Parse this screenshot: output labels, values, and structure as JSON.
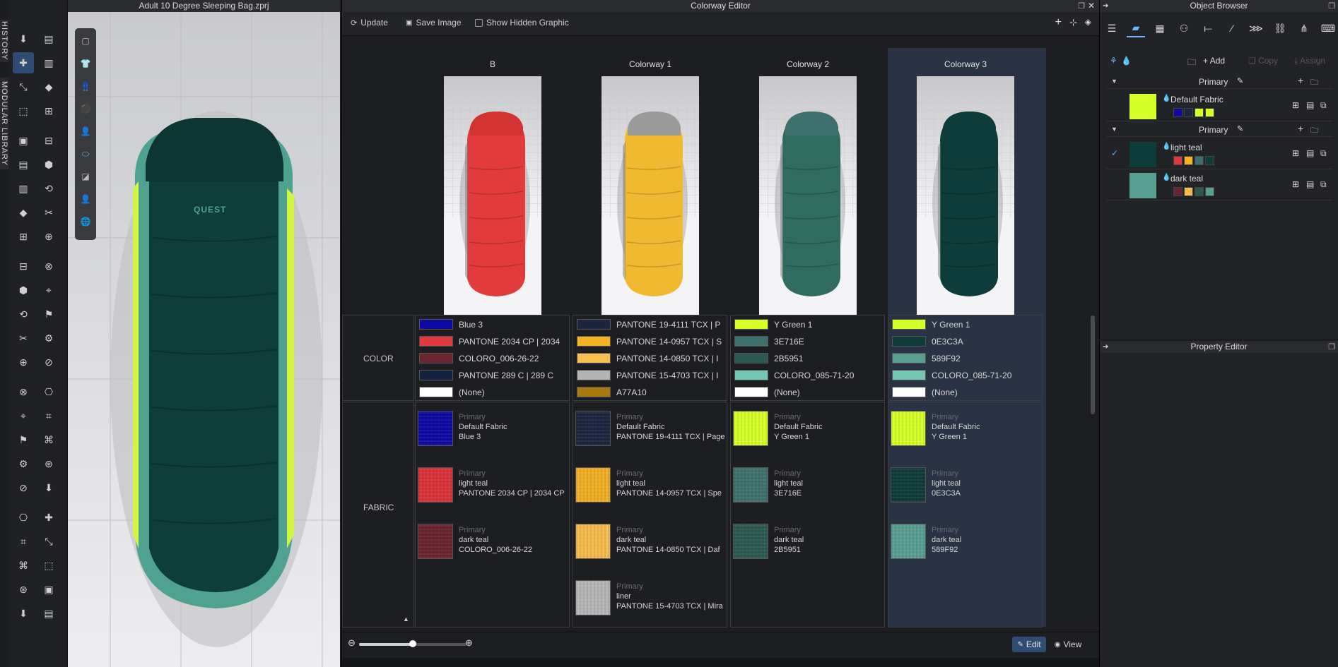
{
  "side_tabs": [
    "HISTORY",
    "MODULAR LIBRARY"
  ],
  "viewport": {
    "title": "Adult 10 Degree Sleeping Bag.zprj",
    "logo_text": "QUEST"
  },
  "colorway_editor": {
    "title": "Colorway Editor",
    "toolbar": {
      "update": "Update",
      "save_image": "Save Image",
      "show_hidden": "Show Hidden Graphic"
    },
    "row_labels": {
      "color": "COLOR",
      "fabric": "FABRIC"
    },
    "columns": [
      {
        "name": "B",
        "bag_color": "#e23b3b",
        "top_color": "#d23434",
        "colors": [
          {
            "hex": "#0e0aa3",
            "label": "Blue 3"
          },
          {
            "hex": "#e13a3e",
            "label": "PANTONE 2034 CP | 2034"
          },
          {
            "hex": "#6a2430",
            "label": "COLORO_006-26-22"
          },
          {
            "hex": "#14213f",
            "label": "PANTONE 289 C | 289 C"
          },
          {
            "hex": "#ffffff",
            "label": "(None)"
          }
        ],
        "fabrics": [
          {
            "hex": "#0e0aa3",
            "primary": "Primary",
            "name": "Default Fabric",
            "color": "Blue 3"
          },
          {
            "hex": "#d93338",
            "primary": "Primary",
            "name": "light teal",
            "color": "PANTONE 2034 CP | 2034 CP"
          },
          {
            "hex": "#6a2430",
            "primary": "Primary",
            "name": "dark teal",
            "color": "COLORO_006-26-22"
          }
        ]
      },
      {
        "name": "Colorway 1",
        "bag_color": "#f1b92f",
        "top_color": "#9b9b9b",
        "colors": [
          {
            "hex": "#1b2540",
            "label": "PANTONE 19-4111 TCX | P"
          },
          {
            "hex": "#f4b31f",
            "label": "PANTONE 14-0957 TCX | S"
          },
          {
            "hex": "#f7bf52",
            "label": "PANTONE 14-0850 TCX | I"
          },
          {
            "hex": "#b3b3b3",
            "label": "PANTONE 15-4703 TCX | I"
          },
          {
            "hex": "#a77a10",
            "label": "A77A10"
          }
        ],
        "fabrics": [
          {
            "hex": "#1b2540",
            "primary": "Primary",
            "name": "Default Fabric",
            "color": "PANTONE 19-4111 TCX | Page"
          },
          {
            "hex": "#f1ad22",
            "primary": "Primary",
            "name": "light teal",
            "color": "PANTONE 14-0957 TCX | Spe"
          },
          {
            "hex": "#f5bb4c",
            "primary": "Primary",
            "name": "dark teal",
            "color": "PANTONE 14-0850 TCX | Daf"
          },
          {
            "hex": "#b5b5b5",
            "primary": "Primary",
            "name": "liner",
            "color": "PANTONE 15-4703 TCX | Mira"
          }
        ]
      },
      {
        "name": "Colorway 2",
        "bag_color": "#2f6b5e",
        "top_color": "#3e716e",
        "colors": [
          {
            "hex": "#d6ff28",
            "label": "Y Green 1"
          },
          {
            "hex": "#3e716e",
            "label": "3E716E"
          },
          {
            "hex": "#2b5951",
            "label": "2B5951"
          },
          {
            "hex": "#74c6b4",
            "label": "COLORO_085-71-20"
          },
          {
            "hex": "#ffffff",
            "label": "(None)"
          }
        ],
        "fabrics": [
          {
            "hex": "#d6ff28",
            "primary": "Primary",
            "name": "Default Fabric",
            "color": "Y Green 1"
          },
          {
            "hex": "#3e716e",
            "primary": "Primary",
            "name": "light teal",
            "color": "3E716E"
          },
          {
            "hex": "#2b5951",
            "primary": "Primary",
            "name": "dark teal",
            "color": "2B5951"
          }
        ]
      },
      {
        "name": "Colorway 3",
        "bag_color": "#0e3c3a",
        "top_color": "#0e3c3a",
        "colors": [
          {
            "hex": "#d6ff28",
            "label": "Y Green 1"
          },
          {
            "hex": "#0e3c3a",
            "label": "0E3C3A"
          },
          {
            "hex": "#589f92",
            "label": "589F92"
          },
          {
            "hex": "#74c6b4",
            "label": "COLORO_085-71-20"
          },
          {
            "hex": "#ffffff",
            "label": "(None)"
          }
        ],
        "fabrics": [
          {
            "hex": "#d6ff28",
            "primary": "Primary",
            "name": "Default Fabric",
            "color": "Y Green 1"
          },
          {
            "hex": "#0e3c3a",
            "primary": "Primary",
            "name": "light teal",
            "color": "0E3C3A"
          },
          {
            "hex": "#589f92",
            "primary": "Primary",
            "name": "dark teal",
            "color": "589F92"
          }
        ]
      }
    ],
    "zoom": 0.5,
    "footer": {
      "edit": "Edit",
      "view": "View"
    }
  },
  "object_browser": {
    "title": "Object Browser",
    "actions": {
      "add": "Add",
      "copy": "Copy",
      "assign": "Assign"
    },
    "groups": [
      {
        "label": "Primary",
        "items": [
          {
            "name": "Default Fabric",
            "thumb": "#d6ff28",
            "checked": false,
            "chips": [
              "#0e0aa3",
              "#1b2540",
              "#d6ff28",
              "#d6ff28"
            ]
          }
        ]
      },
      {
        "label": "Primary",
        "items": [
          {
            "name": "light teal",
            "thumb": "#0e3c3a",
            "checked": true,
            "chips": [
              "#e13a3e",
              "#f4b31f",
              "#3e716e",
              "#0e3c3a"
            ]
          },
          {
            "name": "dark teal",
            "thumb": "#589f92",
            "checked": false,
            "chips": [
              "#6a2430",
              "#f5bb4c",
              "#2b5951",
              "#589f92"
            ]
          }
        ]
      }
    ]
  },
  "property_editor": {
    "title": "Property Editor"
  }
}
